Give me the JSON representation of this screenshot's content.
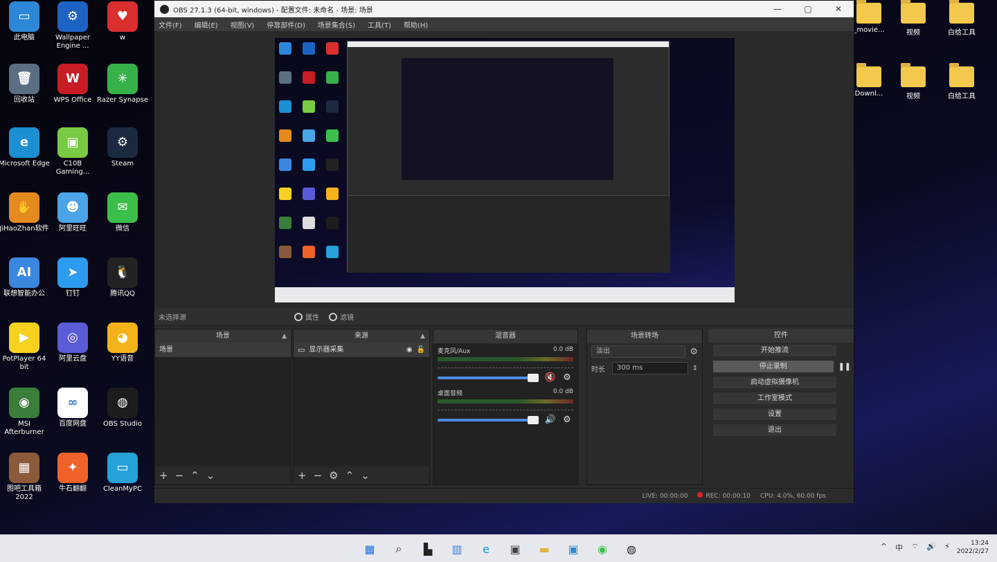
{
  "desktop": {
    "left_icons": [
      {
        "label": "此电脑",
        "color": "#2d86d6",
        "glyph": "▭",
        "icon": "monitor-icon"
      },
      {
        "label": "Wallpaper Engine ...",
        "color": "#1d63c4",
        "glyph": "⚙",
        "icon": "wallpaper-engine-icon"
      },
      {
        "label": "w",
        "color": "#d92f2f",
        "glyph": "♥",
        "icon": "app-icon"
      },
      {
        "label": "回收站",
        "color": "#5b6f82",
        "glyph": "🗑",
        "icon": "recycle-bin-icon"
      },
      {
        "label": "WPS Office",
        "color": "#c81d25",
        "glyph": "W",
        "icon": "wps-office-icon"
      },
      {
        "label": "Razer Synapse",
        "color": "#36b14a",
        "glyph": "✳",
        "icon": "razer-synapse-icon"
      },
      {
        "label": "Microsoft Edge",
        "color": "#1b8fd1",
        "glyph": "e",
        "icon": "edge-icon"
      },
      {
        "label": "C10B Gaming...",
        "color": "#7ac943",
        "glyph": "▣",
        "icon": "gaming-app-icon"
      },
      {
        "label": "Steam",
        "color": "#1b2a40",
        "glyph": "⚙",
        "icon": "steam-icon"
      },
      {
        "label": "JiHaoZhan软件",
        "color": "#e58a20",
        "glyph": "✋",
        "icon": "app-hand-icon"
      },
      {
        "label": "阿里旺旺",
        "color": "#4aa4e6",
        "glyph": "☻",
        "icon": "aliwangwang-icon"
      },
      {
        "label": "微信",
        "color": "#3cbf4a",
        "glyph": "✉",
        "icon": "wechat-icon"
      },
      {
        "label": "联想智能办公",
        "color": "#3b87e0",
        "glyph": "AI",
        "icon": "ai-assistant-icon"
      },
      {
        "label": "钉钉",
        "color": "#2d9cf0",
        "glyph": "➤",
        "icon": "dingtalk-icon"
      },
      {
        "label": "腾讯QQ",
        "color": "#222222",
        "glyph": "🐧",
        "icon": "qq-icon"
      },
      {
        "label": "PotPlayer 64 bit",
        "color": "#f4d21f",
        "glyph": "▶",
        "icon": "potplayer-icon"
      },
      {
        "label": "阿里云盘",
        "color": "#5b5bd6",
        "glyph": "◎",
        "icon": "aliyun-drive-icon"
      },
      {
        "label": "YY语音",
        "color": "#f3b21a",
        "glyph": "◕",
        "icon": "yy-voice-icon"
      },
      {
        "label": "MSI Afterburner",
        "color": "#3b7d3a",
        "glyph": "◉",
        "icon": "msi-afterburner-icon"
      },
      {
        "label": "百度网盘",
        "color": "#ffffff",
        "glyph": "∞",
        "icon": "baidu-netdisk-icon"
      },
      {
        "label": "OBS Studio",
        "color": "#1d1d1d",
        "glyph": "◍",
        "icon": "obs-studio-icon"
      },
      {
        "label": "图吧工具箱 2022",
        "color": "#8a5a3a",
        "glyph": "▦",
        "icon": "toolbox-icon"
      },
      {
        "label": "牛石翻翻",
        "color": "#f0622a",
        "glyph": "✦",
        "icon": "app-bird-icon"
      },
      {
        "label": "CleanMyPC",
        "color": "#26a2d8",
        "glyph": "▭",
        "icon": "cleanmypc-icon"
      }
    ],
    "right_folders": [
      {
        "label": "_movie..."
      },
      {
        "label": "视频"
      },
      {
        "label": "白给工具"
      },
      {
        "label": "Downl..."
      },
      {
        "label": "视频"
      },
      {
        "label": "白给工具"
      }
    ]
  },
  "obs": {
    "title": "OBS 27.1.3 (64-bit, windows) - 配置文件: 未命名 - 场景: 场景",
    "window_buttons": {
      "minimize": "—",
      "maximize": "▢",
      "close": "✕"
    },
    "menu": [
      "文件(F)",
      "编辑(E)",
      "视图(V)",
      "停靠部件(D)",
      "场景集合(S)",
      "工具(T)",
      "帮助(H)"
    ],
    "topline": {
      "scene_tag": "未选择源",
      "chip1": "属性",
      "chip2": "滤镜"
    },
    "scenes": {
      "header": "场景",
      "items": [
        "场景"
      ],
      "pin": "▲"
    },
    "sources": {
      "header": "来源",
      "items": [
        "显示器采集"
      ],
      "pin": "▲"
    },
    "mixer": {
      "header": "混音器",
      "channels": [
        {
          "name": "麦克风/Aux",
          "db": "0.0 dB",
          "muted": true
        },
        {
          "name": "桌面音频",
          "db": "0.0 dB",
          "muted": false
        }
      ]
    },
    "transitions": {
      "header": "场景转场",
      "selected": "淡出",
      "duration_label": "时长",
      "duration_value": "300 ms"
    },
    "controls": {
      "header": "控件",
      "buttons": [
        "开始推流",
        "停止录制",
        "启动虚拟摄像机",
        "工作室模式",
        "设置",
        "退出"
      ],
      "active_index": 1,
      "pause_glyph": "❚❚"
    },
    "status": {
      "live": "LIVE: 00:00:00",
      "rec": "REC: 00:00:10",
      "cpu": "CPU: 4.0%, 60.00 fps"
    }
  },
  "taskbar": {
    "apps": [
      {
        "glyph": "▦",
        "color": "#1a73e8",
        "icon": "start-icon"
      },
      {
        "glyph": "⌕",
        "color": "#222222",
        "icon": "search-icon"
      },
      {
        "glyph": "▙",
        "color": "#222222",
        "icon": "task-view-icon"
      },
      {
        "glyph": "▥",
        "color": "#3a7bd5",
        "icon": "widgets-icon"
      },
      {
        "glyph": "e",
        "color": "#1b8fd1",
        "icon": "edge-icon"
      },
      {
        "glyph": "▣",
        "color": "#444444",
        "icon": "store-icon"
      },
      {
        "glyph": "▬",
        "color": "#e0b33e",
        "icon": "file-explorer-icon"
      },
      {
        "glyph": "▣",
        "color": "#2d86d6",
        "icon": "app-icon"
      },
      {
        "glyph": "◉",
        "color": "#3cbf4a",
        "icon": "app-green-icon"
      },
      {
        "glyph": "◍",
        "color": "#222222",
        "icon": "obs-icon"
      }
    ],
    "tray": [
      "^",
      "中",
      "⌔",
      "🔊",
      "⚡"
    ],
    "time": "13:24",
    "date": "2022/2/27"
  }
}
